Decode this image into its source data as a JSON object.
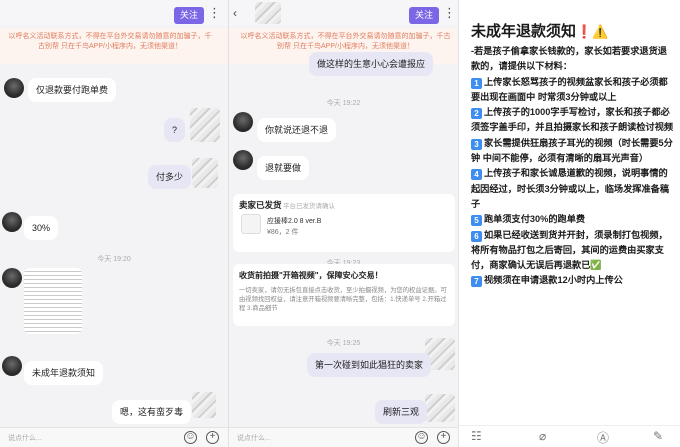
{
  "panel1": {
    "follow_label": "关注",
    "warning": "以呼名义活动联系方式，不得在平台外交易请勿随意的加骗子，千古别帮 只在千鸟APP/小程序内，无须他渠道！",
    "messages": {
      "m1": "仅退款要付跑单费",
      "m2": "?",
      "m3": "付多少",
      "m4": "30%",
      "m5": "未成年退款须知",
      "m6": "嗯，这有蛮歹毒"
    },
    "times": {
      "t1": "今天 19:20"
    },
    "input_placeholder": "说点什么..."
  },
  "panel2": {
    "follow_label": "关注",
    "warning": "以呼名义活动联系方式，不得在平台外交易请勿随意的加骗子，千古别帮 只在千鸟APP/小程序内，无须他渠道！",
    "messages": {
      "m1": "做这样的生意小心会遭报应",
      "m2": "你就说还退不退",
      "m3": "退就要做",
      "m4": "第一次碰到如此猖狂的卖家",
      "m5": "刷新三观"
    },
    "times": {
      "t1": "今天 19:22",
      "t2": "今天 19:23",
      "t3": "今天 19:25"
    },
    "shipped": {
      "title": "卖家已发货",
      "hint": "平台已发货请确认",
      "item_name": "应援棒2.0 8 ver.B",
      "item_price": "¥86，2 件"
    },
    "protect": {
      "title": "收货前拍摄\"开箱视频\"，保障安心交易！",
      "body": "一切卖家，请勿无拆包直接点击收货，至少拍摄视频，为您的权益证据。可由视频找回权益，请注意开箱视频要清晰完整，包括：1.快递单号 2.开箱过程 3.商品细节"
    },
    "input_placeholder": "说点什么..."
  },
  "panel3": {
    "title": "未成年退款须知",
    "title_emoji": "❗⚠️",
    "intro": "-若是孩子偷拿家长钱款的，家长如若要求退货退款的，请提供以下材料：",
    "items": [
      {
        "num": "1",
        "text": "上传家长怒骂孩子的视频盆家长和孩子必须都要出现在画面中 时常须3分钟或以上"
      },
      {
        "num": "2",
        "text": "上传孩子的1000字手写检讨，家长和孩子都必须签字盖手印，并且拍摄家长和孩子朗读检讨视频"
      },
      {
        "num": "3",
        "text": "家长需提供狂扇孩子耳光的视频（时长需要5分钟 中间不能停，必须有清晰的扇耳光声音）"
      },
      {
        "num": "4",
        "text": "上传孩子和家长诚恳道歉的视频，说明事情的起因经过，时长须3分钟或以上，临场发挥准备稿子"
      },
      {
        "num": "5",
        "text": "跑单须支付30%的跑单费"
      },
      {
        "num": "6",
        "text": "如果已经收送到货并开封，须录制打包视频，将所有物品打包之后寄回，其间的运费由买家支付，商家确认无误后再退款已✅"
      },
      {
        "num": "7",
        "text": "视频须在申请退款12小时内上传公"
      }
    ]
  }
}
